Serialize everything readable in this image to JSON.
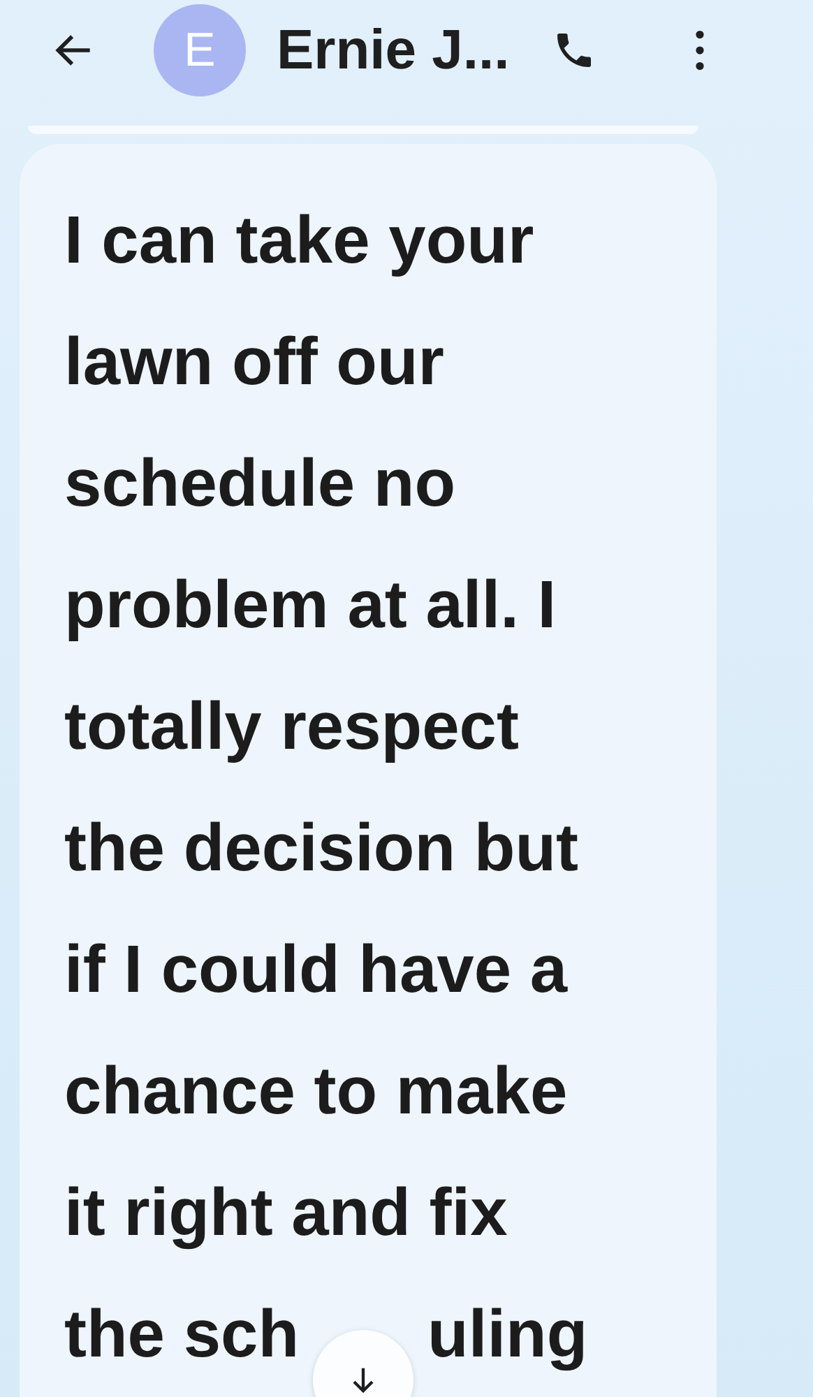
{
  "header": {
    "avatar_letter": "E",
    "contact_name": "Ernie J..."
  },
  "message": {
    "lines": [
      "I can take your",
      "lawn off our",
      "schedule no",
      "problem at all. I",
      "totally respect",
      "the decision but",
      "if I could have a",
      "chance to make",
      "it right and fix"
    ],
    "last_line_start": "the sch",
    "last_line_end": "uling"
  }
}
